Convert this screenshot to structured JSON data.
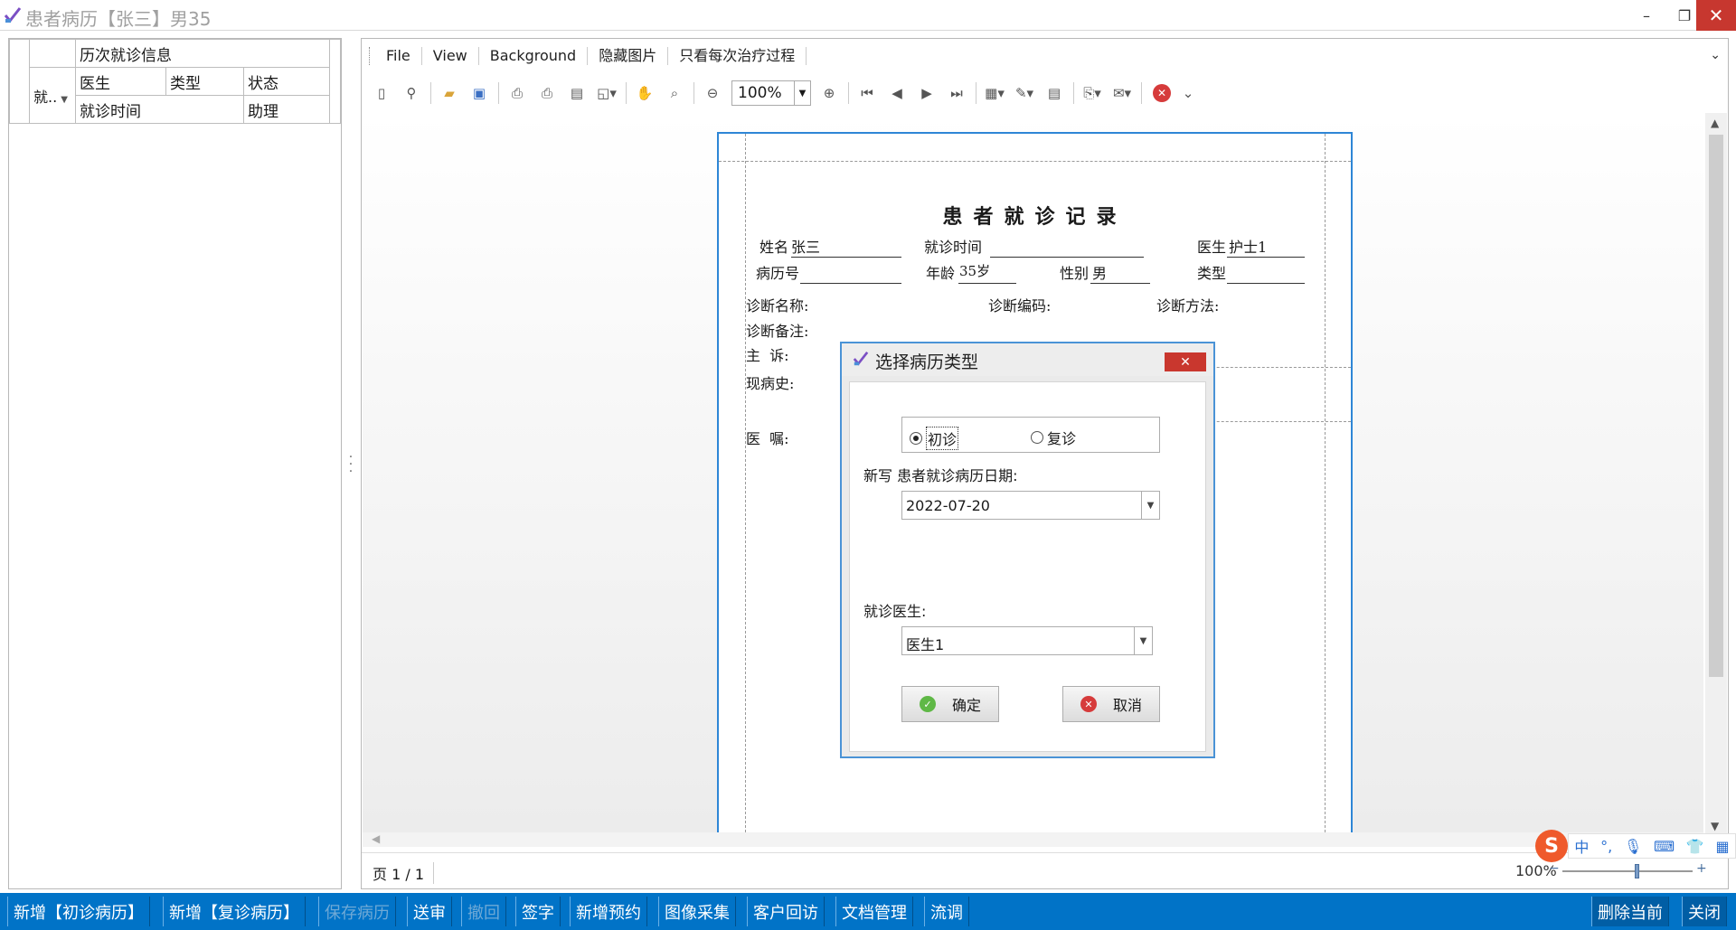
{
  "window": {
    "title": "患者病历【张三】男35"
  },
  "left_grid": {
    "group_header": "历次就诊信息",
    "row_label": "就..",
    "columns_row1": [
      "医生",
      "类型",
      "状态"
    ],
    "columns_row2": [
      "就诊时间",
      "助理"
    ]
  },
  "menu": [
    "File",
    "View",
    "Background",
    "隐藏图片",
    "只看每次治疗过程"
  ],
  "toolbar": {
    "zoom": "100%"
  },
  "status": {
    "page": "页 1 / 1",
    "zoom": "100%"
  },
  "document": {
    "title": "患者就诊记录",
    "name_label": "姓名",
    "name_value": "张三",
    "visit_time_label": "就诊时间",
    "doctor_label": "医生",
    "doctor_value": "护士1",
    "record_no_label": "病历号",
    "age_label": "年龄",
    "age_value": "35岁",
    "sex_label": "性别",
    "sex_value": "男",
    "type_label": "类型",
    "diag_name_label": "诊断名称:",
    "diag_code_label": "诊断编码:",
    "diag_method_label": "诊断方法:",
    "diag_note_label": "诊断备注:",
    "complaint_label": "主  诉:",
    "history_label": "现病史:",
    "advice_label": "医  嘱:"
  },
  "dialog": {
    "title": "选择病历类型",
    "radio_first": "初诊",
    "radio_return": "复诊",
    "date_label": "新写 患者就诊病历日期:",
    "date_value": "2022-07-20",
    "doctor_label": "就诊医生:",
    "doctor_value": "医生1",
    "ok_label": "确定",
    "cancel_label": "取消"
  },
  "bottom_bar": {
    "new_first": "新增【初诊病历】",
    "new_return": "新增【复诊病历】",
    "save": "保存病历",
    "send": "送审",
    "withdraw": "撤回",
    "sign": "签字",
    "new_appt": "新增预约",
    "image_capture": "图像采集",
    "followup": "客户回访",
    "doc_manage": "文档管理",
    "transfer": "流调",
    "delete_current": "删除当前",
    "close": "关闭"
  },
  "ime": {
    "logo": "S",
    "lang": "中"
  },
  "colors": {
    "accent": "#0173c7",
    "dialog_border": "#4a93d6",
    "close_red": "#c9372e"
  }
}
